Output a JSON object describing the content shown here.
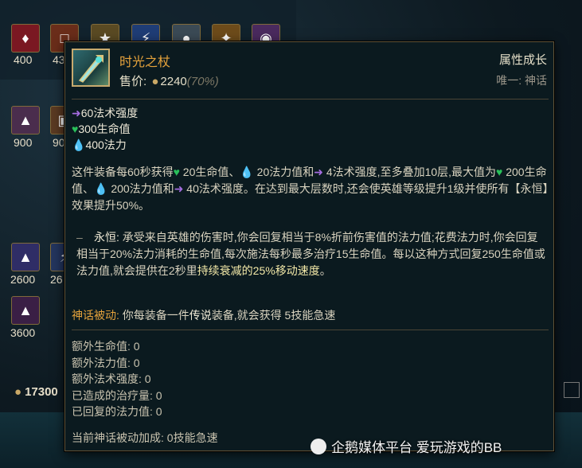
{
  "shop": {
    "row1": [
      {
        "icon": "red-gem-icon",
        "price": "400"
      },
      {
        "icon": "tome-icon",
        "price": "43"
      },
      {
        "icon": "gold-idol-icon",
        "price": ""
      },
      {
        "icon": "blue-wand-icon",
        "price": ""
      },
      {
        "icon": "amulet-icon",
        "price": ""
      },
      {
        "icon": "gold-star-icon",
        "price": ""
      },
      {
        "icon": "purple-orb-icon",
        "price": ""
      }
    ],
    "row2": [
      {
        "icon": "purple-hat-icon",
        "price": "900"
      },
      {
        "icon": "crate-icon",
        "price": "90"
      }
    ],
    "row3": [
      {
        "icon": "mage-hat-icon",
        "price": "2600"
      },
      {
        "icon": "blue-staff-icon",
        "price": "26"
      }
    ],
    "row4": [
      {
        "icon": "dark-hat-icon",
        "price": "3600"
      }
    ],
    "gold": "17300"
  },
  "tooltip": {
    "name": "时光之杖",
    "price_label": "售价:",
    "price_value": "2240",
    "price_pct": "(70%)",
    "category": "属性成长",
    "unique": "唯一: 神话",
    "stats": [
      "60法术强度",
      "300生命值",
      "400法力"
    ],
    "para1": "这件装备每60秒获得💚 20生命值、💧20法力值和🔮4法术强度,至多叠加10层,最大值为💚 200生命值、💧200法力值和🔮40法术强度。在达到最大层数时,还会使英雄等级提升1级并使所有【永恒】效果提升50%。",
    "para1_a": "这件装备每60秒获得",
    "para1_b": " 20生命值、",
    "para1_c": " 20法力值和",
    "para1_d": " 4法术强度,至多叠加10层,最大值为",
    "para1_e": " 200生命值、",
    "para1_f": " 200法力值和",
    "para1_g": " 40法术强度。在达到最大层数时,还会使英雄等级提升1级并使所有【永恒】效果提升50%。",
    "eternal_label": "永恒:",
    "eternal_text": "承受来自英雄的伤害时,你会回复相当于8%折前伤害值的法力值;花费法力时,你会回复相当于20%法力消耗的生命值,每次施法每秒最多治疗15生命值。每以这种方式回复250生命值或法力值,就会提供在2秒里",
    "eternal_highlight": "持续衰减的25%移动速度",
    "eternal_end": "。",
    "mythic_tag": "神话被动:",
    "mythic_a": "你每装备一件",
    "mythic_legend": "传说",
    "mythic_b": "装备,就会获得 5技能急速",
    "trackers": [
      "额外生命值: 0",
      "额外法力值: 0",
      "额外法术强度: 0",
      "已造成的治疗量: 0",
      "已回复的法力值: 0"
    ],
    "footer": "当前神话被动加成:  0技能急速"
  },
  "watermark": "企鹅媒体平台 爱玩游戏的BB",
  "colors": {
    "item_name": "#e6a33c",
    "gold_coin": "#c9a866",
    "hp": "#29c05a",
    "mana": "#3a9ce3",
    "ap": "#a56de0",
    "border": "#5f5237"
  }
}
